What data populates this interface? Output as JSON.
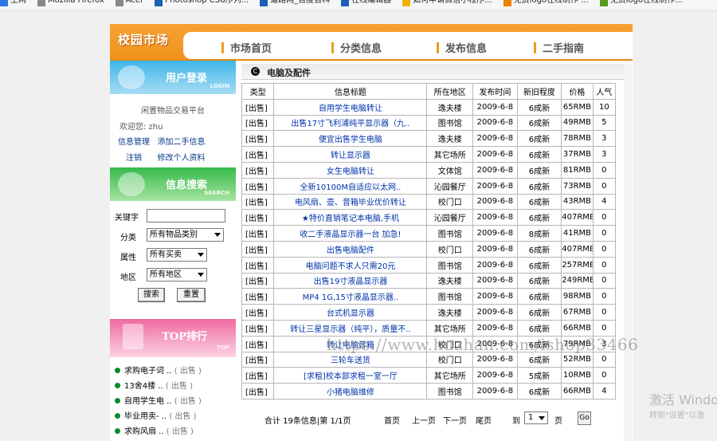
{
  "bookmarks": [
    {
      "label": "生网",
      "color": "#2a7ae2"
    },
    {
      "label": "Mozilla Firefox",
      "color": "#888888"
    },
    {
      "label": "Acer",
      "color": "#888888"
    },
    {
      "label": "Photoshop CS6序列...",
      "color": "#1a5fb4"
    },
    {
      "label": "道路网_百度百科",
      "color": "#1a5fb4"
    },
    {
      "label": "在线编辑器",
      "color": "#1a5fb4"
    },
    {
      "label": "如何申请微信小程序...",
      "color": "#f0b000"
    },
    {
      "label": "免费logo在线制作 ...",
      "color": "#f08000"
    },
    {
      "label": "免费logo在线制作...",
      "color": "#5a9a1a"
    }
  ],
  "header": {
    "logo": "校园市场",
    "nav": [
      "市场首页",
      "分类信息",
      "发布信息",
      "二手指南"
    ]
  },
  "login": {
    "title": "用户登录",
    "sub": "LOGIN",
    "platform": "闲置物品交易平台",
    "welcome": "欢迎您:  zhu",
    "links": [
      "信息管理",
      "添加二手信息",
      "注销",
      "修改个人资料"
    ]
  },
  "search": {
    "title": "信息搜索",
    "sub": "SEARCH",
    "keyword_label": "关键字",
    "keyword_value": "",
    "category_label": "分类",
    "category_value": "所有物品类别",
    "attr_label": "属性",
    "attr_value": "所有买卖",
    "area_label": "地区",
    "area_value": "所有地区",
    "search_btn": "搜索",
    "reset_btn": "重置"
  },
  "top": {
    "title": "TOP排行",
    "sub": "TOP",
    "items": [
      {
        "name": "求购电子词 ..",
        "tag": "( 出售 )"
      },
      {
        "name": "13舍4楼 ..",
        "tag": "( 出售 )"
      },
      {
        "name": "自用学生电 ..",
        "tag": "( 出售 )"
      },
      {
        "name": "毕业用卖- ..",
        "tag": "( 出售 )"
      },
      {
        "name": "求购风扇 ..",
        "tag": "( 出售 )"
      }
    ]
  },
  "main": {
    "icon": "C",
    "title": "电脑及配件",
    "columns": [
      "类型",
      "信息标题",
      "所在地区",
      "发布时间",
      "新旧程度",
      "价格",
      "人气"
    ],
    "rows": [
      [
        "[出售]",
        "自用学生电脑转让",
        "逸夫楼",
        "2009-6-8",
        "6成新",
        "65RMB",
        "10"
      ],
      [
        "[出售]",
        "出售17寸飞利浦纯平显示器（九..",
        "图书馆",
        "2009-6-8",
        "6成新",
        "49RMB",
        "5"
      ],
      [
        "[出售]",
        "便宜出售学生电脑",
        "逸夫楼",
        "2009-6-8",
        "6成新",
        "78RMB",
        "3"
      ],
      [
        "[出售]",
        "转让显示器",
        "其它场所",
        "2009-6-8",
        "6成新",
        "37RMB",
        "3"
      ],
      [
        "[出售]",
        "女生电脑转让",
        "文体馆",
        "2009-6-8",
        "6成新",
        "81RMB",
        "0"
      ],
      [
        "[出售]",
        "全新10100M自适应以太网..",
        "沁园餐厅",
        "2009-6-8",
        "6成新",
        "73RMB",
        "0"
      ],
      [
        "[出售]",
        "电风扇、壶、音箱毕业优价转让",
        "校门口",
        "2009-6-8",
        "6成新",
        "43RMB",
        "4"
      ],
      [
        "[出售]",
        "★特价直销笔记本电脑,手机",
        "沁园餐厅",
        "2009-6-8",
        "6成新",
        "407RMB",
        "0"
      ],
      [
        "[出售]",
        "收二手液晶显示器一台 加急!",
        "图书馆",
        "2009-6-8",
        "8成新",
        "41RMB",
        "0"
      ],
      [
        "[出售]",
        "出售电脑配件",
        "校门口",
        "2009-6-8",
        "6成新",
        "407RMB",
        "0"
      ],
      [
        "[出售]",
        "电脑问题不求人只需20元",
        "图书馆",
        "2009-6-8",
        "6成新",
        "257RMB",
        "0"
      ],
      [
        "[出售]",
        "出售19寸液晶显示器",
        "逸夫楼",
        "2009-6-8",
        "6成新",
        "249RMB",
        "0"
      ],
      [
        "[出售]",
        "MP4 1G,15寸液晶显示器..",
        "图书馆",
        "2009-6-8",
        "6成新",
        "98RMB",
        "0"
      ],
      [
        "[出售]",
        "台式机显示器",
        "逸夫楼",
        "2009-6-8",
        "6成新",
        "67RMB",
        "0"
      ],
      [
        "[出售]",
        "转让三星显示器（纯平），质量不..",
        "其它场所",
        "2009-6-8",
        "6成新",
        "66RMB",
        "0"
      ],
      [
        "[出售]",
        "转让电脑音箱",
        "校门口",
        "2009-6-8",
        "6成新",
        "79RMB",
        "3"
      ],
      [
        "[出售]",
        "三轮车送货",
        "校门口",
        "2009-6-8",
        "6成新",
        "52RMB",
        "0"
      ],
      [
        "[出售]",
        "[求租]校本部求租一室一厅",
        "其它场所",
        "2009-6-8",
        "5成新",
        "10RMB",
        "0"
      ],
      [
        "[出售]",
        "小猪电脑维修",
        "图书馆",
        "2009-6-8",
        "6成新",
        "66RMB",
        "4"
      ]
    ]
  },
  "pager": {
    "summary": "合计 19条信息|第 1/1页",
    "first": "首页",
    "prev": "上一页",
    "next": "下一页",
    "last": "尾页",
    "goto_label": "到",
    "page_value": "1",
    "page_unit": "页",
    "go_btn": "Go"
  },
  "watermark": "https://www.huzhan.com/ishop33466",
  "windows": {
    "line1": "激活 Windo",
    "line2": "转到\"设置\"以激"
  }
}
